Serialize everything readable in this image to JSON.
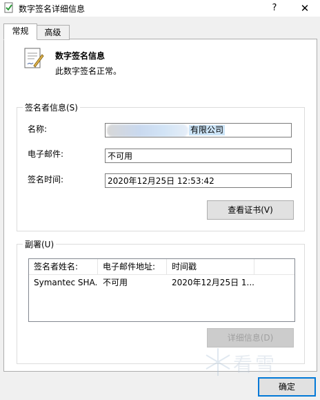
{
  "window": {
    "title": "数字签名详细信息",
    "help_label": "?",
    "close_label": "✕"
  },
  "tabs": [
    {
      "label": "常规",
      "selected": true
    },
    {
      "label": "高级",
      "selected": false
    }
  ],
  "header": {
    "icon": "certificate-icon",
    "title": "数字签名信息",
    "subtitle": "此数字签名正常。"
  },
  "signer": {
    "group_label": "签名者信息(S)",
    "name_label": "名称:",
    "name_value": "有限公司",
    "email_label": "电子邮件:",
    "email_value": "不可用",
    "time_label": "签名时间:",
    "time_value": "2020年12月25日 12:53:42",
    "view_cert_label": "查看证书(V)"
  },
  "countersignature": {
    "group_label": "副署(U)",
    "columns": [
      "签名者姓名:",
      "电子邮件地址:",
      "时间戳"
    ],
    "rows": [
      [
        "Symantec SHA...",
        "不可用",
        "2020年12月25日 1..."
      ]
    ],
    "details_label": "详细信息(D)"
  },
  "watermark": {
    "text": "看雪"
  },
  "footer": {
    "ok_label": "确定"
  },
  "colors": {
    "accent": "#0078d7",
    "selection": "#cce4f7",
    "window_bg": "#f0f0f0"
  }
}
